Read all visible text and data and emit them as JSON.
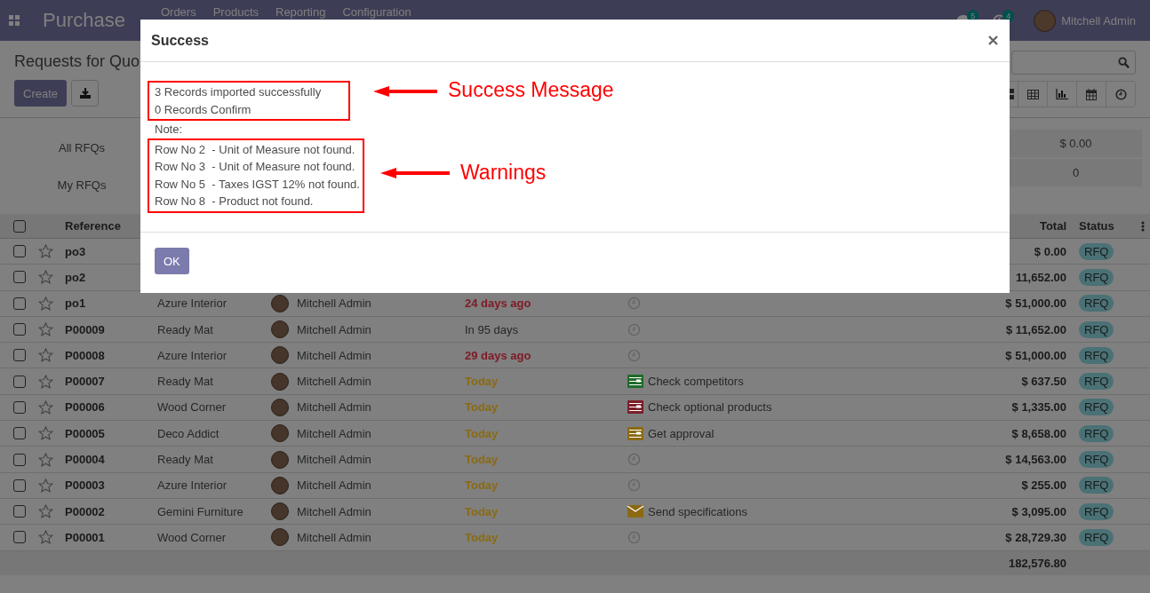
{
  "navbar": {
    "app_name": "Purchase",
    "menu": [
      "Orders",
      "Products",
      "Reporting",
      "Configuration"
    ],
    "messages_badge": "5",
    "activities_badge": "4",
    "user": "Mitchell Admin"
  },
  "control_panel": {
    "breadcrumb": "Requests for Quo",
    "create_button": "Create"
  },
  "dashboard": {
    "labels": [
      "All RFQs",
      "My RFQs"
    ],
    "values": [
      "$ 0.00",
      "0"
    ]
  },
  "table": {
    "columns": [
      "Reference",
      "Total",
      "Status"
    ],
    "select_all_checked": false,
    "rows": [
      {
        "checked": false,
        "reference": "po3",
        "total": "$ 0.00",
        "status": "RFQ"
      },
      {
        "checked": false,
        "reference": "po2",
        "total": "11,652.00",
        "status": "RFQ"
      },
      {
        "checked": false,
        "reference": "po1",
        "vendor": "Azure Interior",
        "buyer": "Mitchell Admin",
        "deadline": {
          "text": "24 days ago",
          "color": "#7f1a25"
        },
        "activity": {
          "kind": "none"
        },
        "total": "$ 51,000.00",
        "status": "RFQ"
      },
      {
        "checked": false,
        "reference": "P00009",
        "vendor": "Ready Mat",
        "buyer": "Mitchell Admin",
        "deadline": {
          "text": "In 95 days",
          "color": "#262626"
        },
        "activity": {
          "kind": "none"
        },
        "total": "$ 11,652.00",
        "status": "RFQ"
      },
      {
        "checked": false,
        "reference": "P00008",
        "vendor": "Azure Interior",
        "buyer": "Mitchell Admin",
        "deadline": {
          "text": "29 days ago",
          "color": "#7f1a25"
        },
        "activity": {
          "kind": "none"
        },
        "total": "$ 51,000.00",
        "status": "RFQ"
      },
      {
        "checked": false,
        "reference": "P00007",
        "vendor": "Ready Mat",
        "buyer": "Mitchell Admin",
        "deadline": {
          "text": "Today",
          "color": "#8a6a12"
        },
        "activity": {
          "kind": "todo",
          "color": "#1f6b2a",
          "text": "Check competitors"
        },
        "total": "$ 637.50",
        "status": "RFQ"
      },
      {
        "checked": false,
        "reference": "P00006",
        "vendor": "Wood Corner",
        "buyer": "Mitchell Admin",
        "deadline": {
          "text": "Today",
          "color": "#8a6a12"
        },
        "activity": {
          "kind": "todo",
          "color": "#7a1e28",
          "text": "Check optional products"
        },
        "total": "$ 1,335.00",
        "status": "RFQ"
      },
      {
        "checked": false,
        "reference": "P00005",
        "vendor": "Deco Addict",
        "buyer": "Mitchell Admin",
        "deadline": {
          "text": "Today",
          "color": "#8a6a12"
        },
        "activity": {
          "kind": "todo",
          "color": "#8a6a12",
          "text": "Get approval"
        },
        "total": "$ 8,658.00",
        "status": "RFQ"
      },
      {
        "checked": false,
        "reference": "P00004",
        "vendor": "Ready Mat",
        "buyer": "Mitchell Admin",
        "deadline": {
          "text": "Today",
          "color": "#8a6a12"
        },
        "activity": {
          "kind": "none"
        },
        "total": "$ 14,563.00",
        "status": "RFQ"
      },
      {
        "checked": false,
        "reference": "P00003",
        "vendor": "Azure Interior",
        "buyer": "Mitchell Admin",
        "deadline": {
          "text": "Today",
          "color": "#8a6a12"
        },
        "activity": {
          "kind": "none"
        },
        "total": "$ 255.00",
        "status": "RFQ"
      },
      {
        "checked": false,
        "reference": "P00002",
        "vendor": "Gemini Furniture",
        "buyer": "Mitchell Admin",
        "deadline": {
          "text": "Today",
          "color": "#8a6a12"
        },
        "activity": {
          "kind": "mail",
          "color": "#8a6a12",
          "text": "Send specifications"
        },
        "total": "$ 3,095.00",
        "status": "RFQ"
      },
      {
        "checked": false,
        "reference": "P00001",
        "vendor": "Wood Corner",
        "buyer": "Mitchell Admin",
        "deadline": {
          "text": "Today",
          "color": "#8a6a12"
        },
        "activity": {
          "kind": "none"
        },
        "total": "$ 28,729.30",
        "status": "RFQ"
      }
    ],
    "footer_total": "182,576.80"
  },
  "dialog": {
    "title": "Success",
    "messages": [
      "3 Records imported successfully",
      "0 Records Confirm"
    ],
    "note": "Note:",
    "warnings": [
      "Row No 2  - Unit of Measure not found.",
      "Row No 3  - Unit of Measure not found.",
      "Row No 5  - Taxes IGST 12% not found.",
      "Row No 8  - Product not found."
    ],
    "success_annotation": "Success Message",
    "warnings_annotation": "Warnings",
    "ok_button": "OK"
  }
}
